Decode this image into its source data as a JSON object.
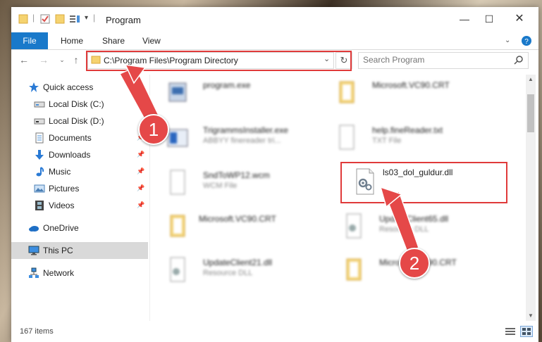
{
  "window": {
    "title": "Program"
  },
  "ribbon": {
    "tabs": [
      "File",
      "Home",
      "Share",
      "View"
    ]
  },
  "nav": {
    "address": "C:\\Program Files\\Program Directory",
    "search_placeholder": "Search Program"
  },
  "sidebar": {
    "items": [
      {
        "label": "Quick access",
        "icon": "star-icon",
        "pinned": false
      },
      {
        "label": "Local Disk (C:)",
        "icon": "drive-icon",
        "pinned": false
      },
      {
        "label": "Local Disk (D:)",
        "icon": "drive-icon",
        "pinned": false
      },
      {
        "label": "Documents",
        "icon": "documents-icon",
        "pinned": true
      },
      {
        "label": "Downloads",
        "icon": "download-arrow-icon",
        "pinned": true
      },
      {
        "label": "Music",
        "icon": "music-note-icon",
        "pinned": true
      },
      {
        "label": "Pictures",
        "icon": "pictures-icon",
        "pinned": true
      },
      {
        "label": "Videos",
        "icon": "film-icon",
        "pinned": true
      },
      {
        "label": "OneDrive",
        "icon": "cloud-icon",
        "pinned": false
      },
      {
        "label": "This PC",
        "icon": "monitor-icon",
        "pinned": false,
        "selected": true
      },
      {
        "label": "Network",
        "icon": "network-icon",
        "pinned": false
      }
    ]
  },
  "files": [
    {
      "name": "program.exe",
      "type": ""
    },
    {
      "name": "Microsoft.VC90.CRT",
      "type": ""
    },
    {
      "name": "TrigrammsInstaller.exe",
      "type": "ABBYY finereader tri..."
    },
    {
      "name": "help.fineReader.txt",
      "type": "TXT File"
    },
    {
      "name": "SndToWP12.wcm",
      "type": "WCM File"
    },
    {
      "name": "Microsoft.VC90.CRT",
      "type": ""
    },
    {
      "name": "UpdateClient65.dll",
      "type": "Resource DLL"
    },
    {
      "name": "UpdateClient21.dll",
      "type": "Resource DLL"
    },
    {
      "name": "Microsoft.VC90.CRT",
      "type": ""
    }
  ],
  "highlighted_file": {
    "name": "ls03_dol_guldur.dll"
  },
  "status": {
    "items_count": "167 items"
  },
  "annotations": {
    "step1": "1",
    "step2": "2"
  },
  "colors": {
    "accent": "#1979ca",
    "highlight": "#e03a3a",
    "badge": "#e54848"
  }
}
